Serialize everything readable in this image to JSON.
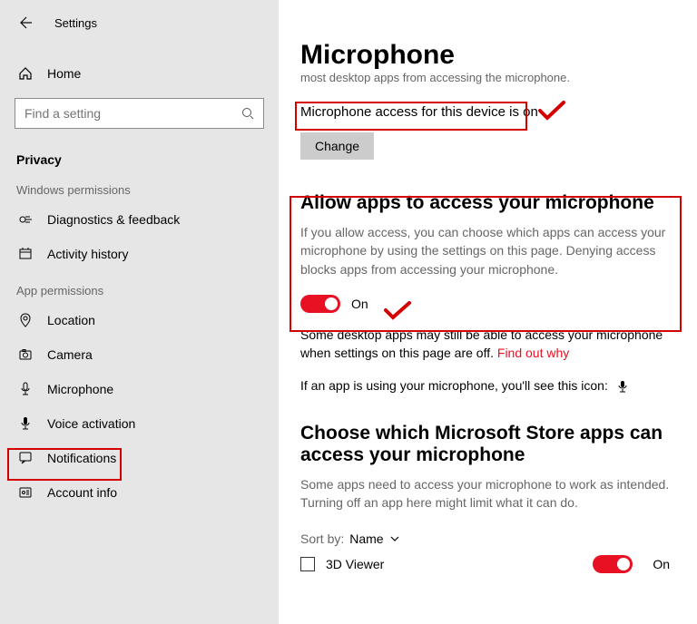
{
  "app_title": "Settings",
  "search_placeholder": "Find a setting",
  "home_label": "Home",
  "section_label": "Privacy",
  "group_windows": "Windows permissions",
  "group_app": "App permissions",
  "nav": {
    "diagnostics": "Diagnostics & feedback",
    "activity": "Activity history",
    "location": "Location",
    "camera": "Camera",
    "microphone": "Microphone",
    "voice": "Voice activation",
    "notifications": "Notifications",
    "account": "Account info"
  },
  "page_title": "Microphone",
  "cut_text": "most desktop apps from accessing the microphone.",
  "access_status": "Microphone access for this device is on",
  "change_label": "Change",
  "allow_heading": "Allow apps to access your microphone",
  "allow_desc": "If you allow access, you can choose which apps can access your microphone by using the settings on this page. Denying access blocks apps from accessing your microphone.",
  "toggle_state": "On",
  "desktop_note_a": "Some desktop apps may still be able to access your microphone when settings on this page are off. ",
  "desktop_note_link": "Find out why",
  "icon_note": "If an app is using your microphone, you'll see this icon:",
  "choose_heading": "Choose which Microsoft Store apps can access your microphone",
  "choose_desc": "Some apps need to access your microphone to work as intended. Turning off an app here might limit what it can do.",
  "sort_label": "Sort by:",
  "sort_value": "Name",
  "app1_name": "3D Viewer",
  "app1_state": "On"
}
